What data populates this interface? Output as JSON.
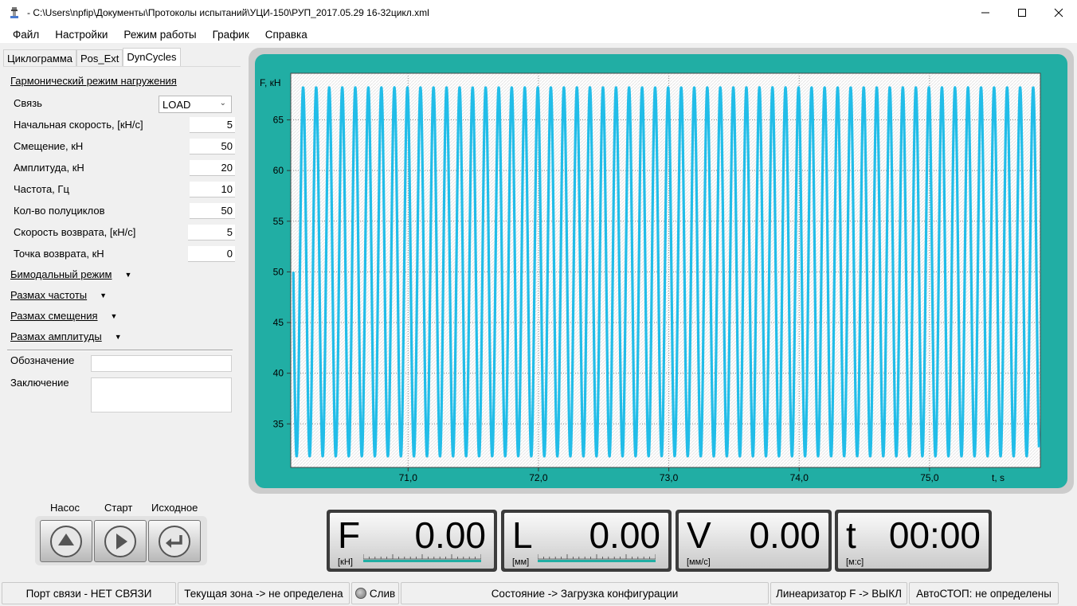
{
  "window": {
    "title": "- C:\\Users\\npfip\\Документы\\Протоколы испытаний\\УЦИ-150\\РУП_2017.05.29 16-32цикл.xml",
    "icons": {
      "app": "app-icon",
      "minimize": "minimize-icon",
      "maximize": "maximize-icon",
      "close": "close-icon"
    }
  },
  "menu": [
    "Файл",
    "Настройки",
    "Режим работы",
    "График",
    "Справка"
  ],
  "tabs": [
    "Циклограмма",
    "Pos_Ext",
    "DynCycles"
  ],
  "active_tab": "DynCycles",
  "params": {
    "section_title": "Гармонический режим нагружения",
    "link_label": "Связь",
    "link_value": "LOAD",
    "rows": [
      {
        "label": "Начальная скорость, [кН/с]",
        "value": "5"
      },
      {
        "label": "Смещение, кН",
        "value": "50"
      },
      {
        "label": "Амплитуда, кН",
        "value": "20"
      },
      {
        "label": "Частота, Гц",
        "value": "10"
      },
      {
        "label": "Кол-во полуциклов",
        "value": "50"
      },
      {
        "label": "Скорость возврата, [кН/с]",
        "value": "5"
      },
      {
        "label": "Точка возврата, кН",
        "value": "0"
      }
    ],
    "collapsibles": [
      "Бимодальный режим",
      "Размах частоты",
      "Размах смещения",
      "Размах амплитуды"
    ],
    "designation_label": "Обозначение",
    "designation_value": "",
    "conclusion_label": "Заключение",
    "conclusion_value": ""
  },
  "controls": {
    "labels": [
      "Насос",
      "Старт",
      "Исходное"
    ],
    "icons": [
      "up-arrow-icon",
      "play-icon",
      "return-icon"
    ]
  },
  "chart_data": {
    "type": "line",
    "ylabel": "F, кН",
    "xlabel": "t, s",
    "x_ticks": [
      "71,0",
      "72,0",
      "73,0",
      "74,0",
      "75,0"
    ],
    "y_ticks": [
      "35",
      "40",
      "45",
      "50",
      "55",
      "60",
      "65"
    ],
    "xlim": [
      70.1,
      75.85
    ],
    "ylim": [
      30.7,
      69.6
    ],
    "grid": true,
    "series": [
      {
        "color": "#22bde8",
        "frequency_hz": 10,
        "offset": 50,
        "amplitude": 18.2,
        "x_start": 70.12,
        "x_end": 75.84,
        "phase_peak_at": 70.195
      }
    ]
  },
  "displays": [
    {
      "letter": "F",
      "value": "0.00",
      "unit": "[кН]",
      "scale": true
    },
    {
      "letter": "L",
      "value": "0.00",
      "unit": "[мм]",
      "scale": true
    },
    {
      "letter": "V",
      "value": "0.00",
      "unit": "[мм/с]",
      "scale": false
    },
    {
      "letter": "t",
      "value": "00:00",
      "unit": "[м:с]",
      "scale": false
    }
  ],
  "status": {
    "port": "Порт связи  - НЕТ СВЯЗИ",
    "zone": "Текущая зона -> не определена",
    "drain": "Слив",
    "state": "Состояние -> Загрузка конфигурации",
    "linearizer": "Линеаризатор F -> ВЫКЛ",
    "autostop": "АвтоСТОП: не определены"
  }
}
